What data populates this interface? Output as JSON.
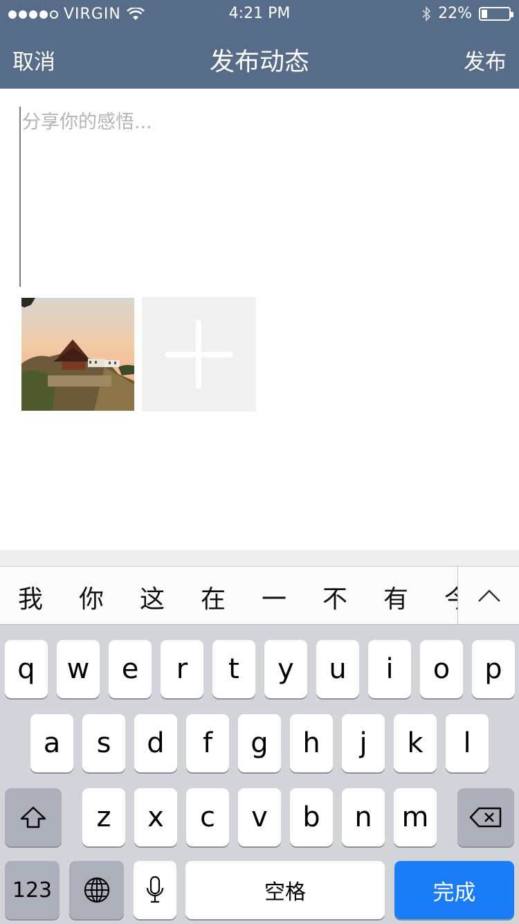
{
  "status_bar": {
    "carrier": "VIRGIN",
    "time": "4:21 PM",
    "battery_text": "22%",
    "battery_level": 0.22
  },
  "nav": {
    "cancel_label": "取消",
    "title": "发布动态",
    "publish_label": "发布"
  },
  "composer": {
    "placeholder": "分享你的感悟...",
    "value": ""
  },
  "candidates": [
    "我",
    "你",
    "这",
    "在",
    "一",
    "不",
    "有",
    "今"
  ],
  "keyboard": {
    "row1": [
      "q",
      "w",
      "e",
      "r",
      "t",
      "y",
      "u",
      "i",
      "o",
      "p"
    ],
    "row2": [
      "a",
      "s",
      "d",
      "f",
      "g",
      "h",
      "j",
      "k",
      "l"
    ],
    "row3": [
      "z",
      "x",
      "c",
      "v",
      "b",
      "n",
      "m"
    ],
    "numbers_label": "123",
    "space_label": "空格",
    "done_label": "完成"
  },
  "colors": {
    "header": "#566c88",
    "done_key": "#1a7cf6",
    "keyboard_bg": "#d1d4d9"
  }
}
